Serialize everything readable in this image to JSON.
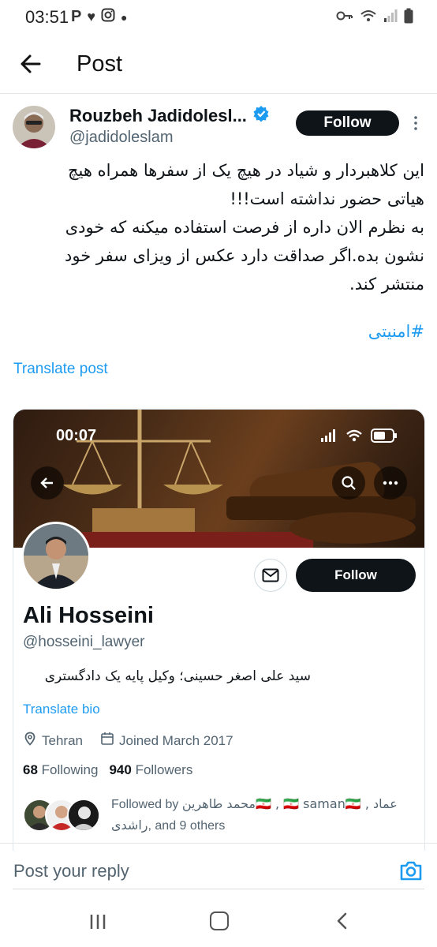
{
  "status_bar": {
    "time": "03:51",
    "left_icons": [
      "p-icon",
      "heart-icon",
      "instagram-icon",
      "dot-icon"
    ],
    "right_icons": [
      "key-icon",
      "wifi-icon",
      "signal-icon",
      "battery-icon"
    ]
  },
  "header": {
    "title": "Post"
  },
  "post": {
    "author_name": "Rouzbeh Jadidolesl...",
    "author_handle": "@jadidoleslam",
    "verified": true,
    "follow_label": "Follow",
    "text": "این کلاهبردار و شیاد در هیچ یک از سفرها همراه هیچ\nهیاتی حضور نداشته است!!!\nبه نظرم الان داره از فرصت استفاده میکنه که خودی\nنشون بده.اگر صداقت دارد عکس از ویزای سفر خود\nمنتشر کند.",
    "hashtag": "#امنیتی",
    "translate_label": "Translate post"
  },
  "embedded_profile": {
    "inner_time": "00:07",
    "name": "Ali Hosseini",
    "handle": "@hosseini_lawyer",
    "follow_label": "Follow",
    "bio": "سید علی اصغر حسینی؛ وکیل پایه یک دادگستری",
    "translate_bio_label": "Translate bio",
    "location": "Tehran",
    "joined": "Joined March 2017",
    "following_count": "68",
    "following_label": "Following",
    "followers_count": "940",
    "followers_label": "Followers",
    "followed_by_prefix": "Followed by",
    "followed_by_names": "محمد طاهرین🇮🇷 , 🇮🇷 saman🇮🇷 , عماد",
    "followed_by_line2": "راشدی",
    "followed_by_suffix": ", and 9 others"
  },
  "reply": {
    "placeholder": "Post your reply"
  },
  "colors": {
    "accent": "#1d9bf0",
    "text": "#0f1419",
    "secondary": "#536471",
    "button": "#0f1419"
  }
}
